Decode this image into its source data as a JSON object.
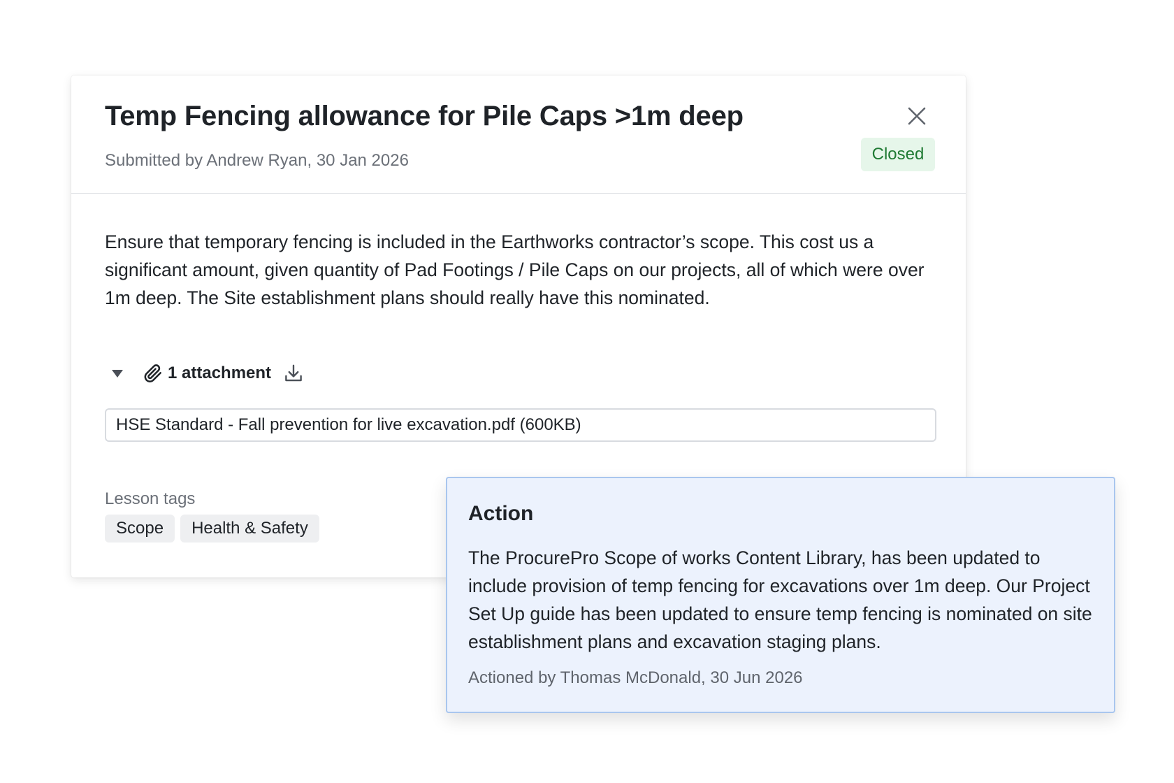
{
  "lesson": {
    "title": "Temp Fencing allowance for Pile Caps >1m deep",
    "submitted": "Submitted by Andrew Ryan, 30 Jan 2026",
    "status": "Closed",
    "description": "Ensure that temporary fencing is included in the Earthworks contractor’s scope. This cost us a significant amount, given quantity of Pad Footings / Pile Caps on our projects, all of which were over 1m deep. The Site establishment plans should really have this nominated."
  },
  "attachments": {
    "label": "1 attachment",
    "files": [
      {
        "name": "HSE Standard - Fall prevention for live excavation.pdf (600KB)"
      }
    ]
  },
  "tags": {
    "label": "Lesson tags",
    "items": [
      "Scope",
      "Health & Safety"
    ]
  },
  "action": {
    "title": "Action",
    "text": "The ProcurePro Scope of works Content Library, has been updated to include provision of temp fencing for excavations over 1m deep. Our Project Set Up guide has been updated to ensure temp fencing is nominated on site establishment plans and excavation staging plans.",
    "actioned_by": "Actioned by Thomas McDonald, 30 Jun 2026"
  },
  "icons": {
    "close": "close-icon",
    "toggle": "caret-down-icon",
    "attachment": "paperclip-icon",
    "download": "download-icon"
  },
  "colors": {
    "status_bg": "#e6f6ea",
    "status_text": "#1f7a33",
    "action_bg": "#ecf2fd",
    "action_border": "#a9c6ee"
  }
}
